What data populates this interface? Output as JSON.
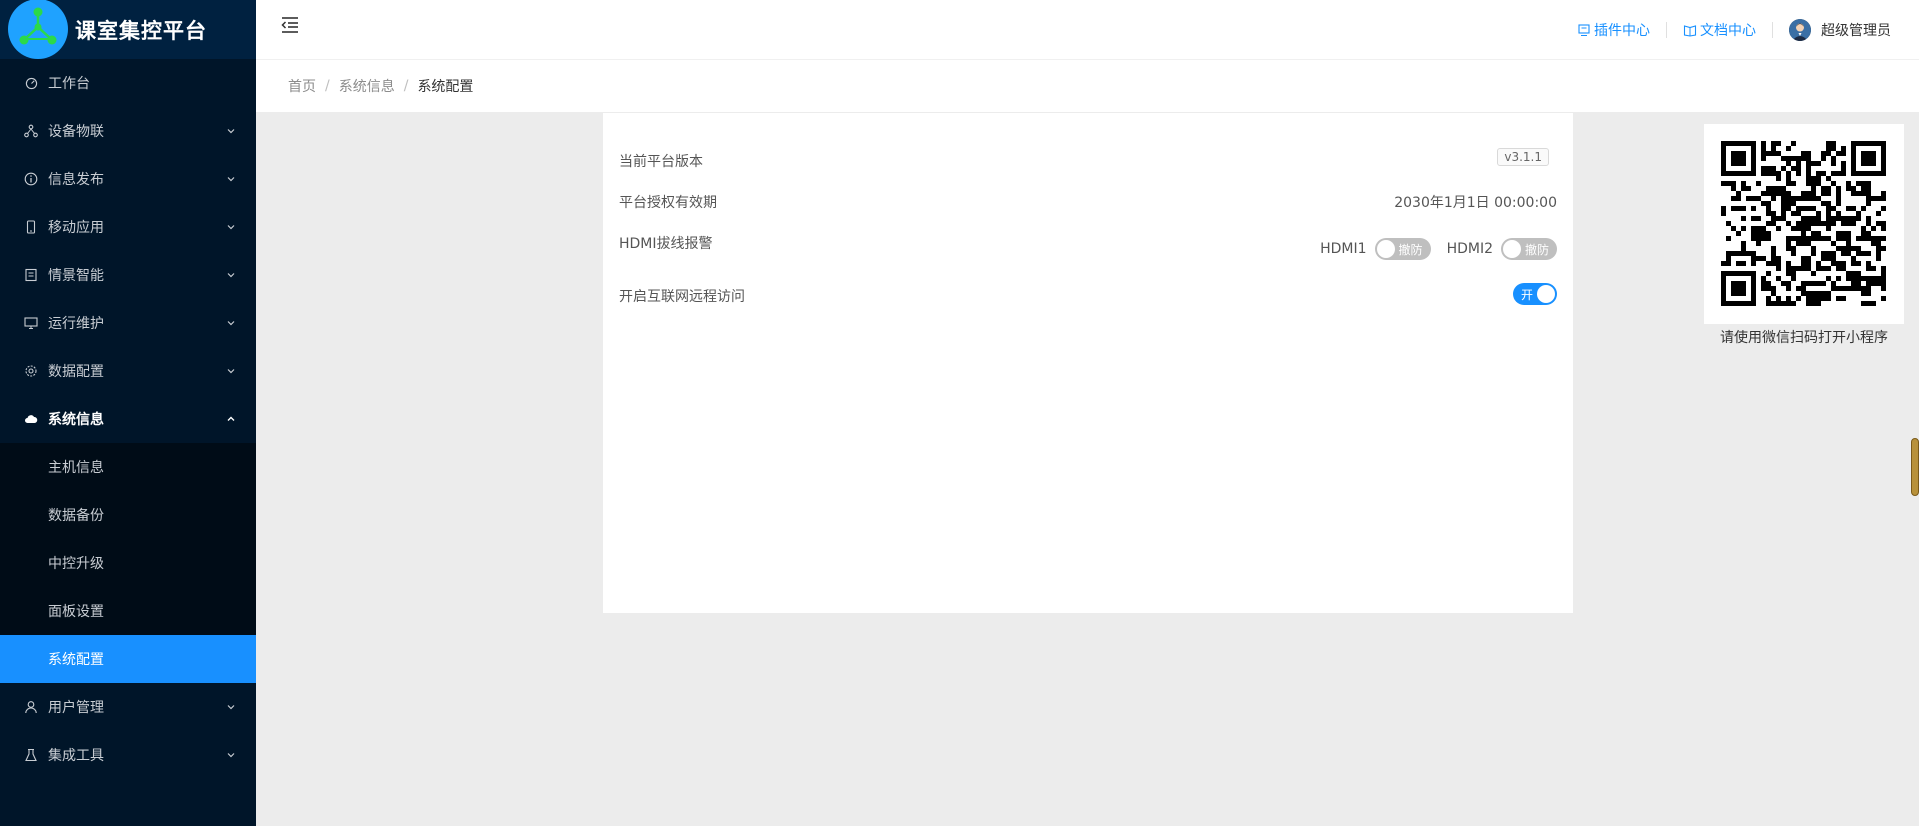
{
  "app": {
    "title": "课室集控平台"
  },
  "colors": {
    "sidebar_bg": "#001529",
    "accent": "#1890ff"
  },
  "sidebar": {
    "items": [
      {
        "label": "工作台",
        "icon": "dashboard-icon"
      },
      {
        "label": "设备物联",
        "icon": "network-icon"
      },
      {
        "label": "信息发布",
        "icon": "info-icon"
      },
      {
        "label": "移动应用",
        "icon": "mobile-icon"
      },
      {
        "label": "情景智能",
        "icon": "scene-icon"
      },
      {
        "label": "运行维护",
        "icon": "monitor-icon"
      },
      {
        "label": "数据配置",
        "icon": "gear-icon"
      },
      {
        "label": "系统信息",
        "icon": "cloud-icon"
      },
      {
        "label": "用户管理",
        "icon": "user-icon"
      },
      {
        "label": "集成工具",
        "icon": "flask-icon"
      }
    ],
    "submenu": [
      {
        "label": "主机信息"
      },
      {
        "label": "数据备份"
      },
      {
        "label": "中控升级"
      },
      {
        "label": "面板设置"
      },
      {
        "label": "系统配置"
      }
    ]
  },
  "header": {
    "plugin_center": "插件中心",
    "doc_center": "文档中心",
    "user_name": "超级管理员"
  },
  "breadcrumb": [
    "首页",
    "系统信息",
    "系统配置"
  ],
  "config": {
    "version_label": "当前平台版本",
    "version_value": "v3.1.1",
    "license_label": "平台授权有效期",
    "license_value": "2030年1月1日 00:00:00",
    "hdmi_label": "HDMI拔线报警",
    "hdmi1_label": "HDMI1",
    "hdmi1_state": "撤防",
    "hdmi2_label": "HDMI2",
    "hdmi2_state": "撤防",
    "remote_label": "开启互联网远程访问",
    "remote_state": "开"
  },
  "qr": {
    "caption": "请使用微信扫码打开小程序"
  }
}
